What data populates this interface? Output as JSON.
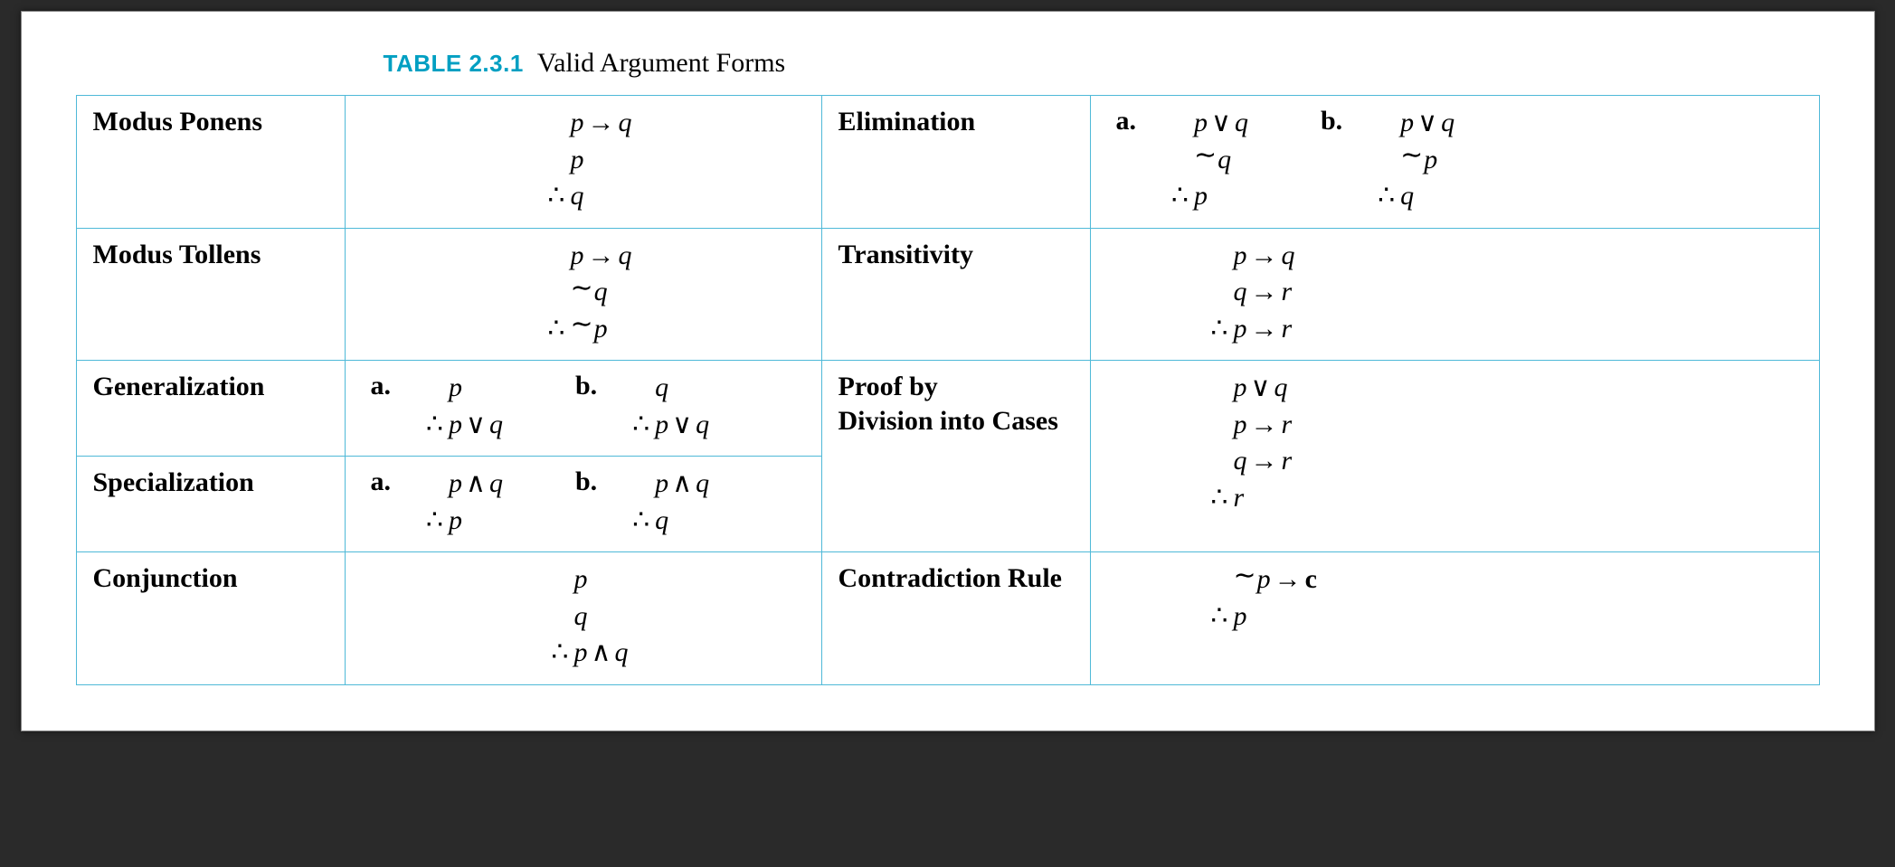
{
  "caption_label": "TABLE 2.3.1",
  "caption_title": "Valid Argument Forms",
  "sym": {
    "arrow": "→",
    "or": "∨",
    "and": "∧",
    "neg": "∼",
    "therefore": "∴"
  },
  "sub_a": "a.",
  "sub_b": "b.",
  "rows": {
    "modus_ponens": {
      "name": "Modus Ponens",
      "lines": [
        "p → q",
        "p",
        "∴ q"
      ]
    },
    "modus_tollens": {
      "name": "Modus Tollens",
      "lines": [
        "p → q",
        "∼q",
        "∴ ∼p"
      ]
    },
    "generalization": {
      "name": "Generalization",
      "a": [
        "p",
        "∴ p ∨ q"
      ],
      "b": [
        "q",
        "∴ p ∨ q"
      ]
    },
    "specialization": {
      "name": "Specialization",
      "a": [
        "p ∧ q",
        "∴ p"
      ],
      "b": [
        "p ∧ q",
        "∴ q"
      ]
    },
    "conjunction": {
      "name": "Conjunction",
      "lines": [
        "p",
        "q",
        "∴ p ∧ q"
      ]
    },
    "elimination": {
      "name": "Elimination",
      "a": [
        "p ∨ q",
        "∼q",
        "∴ p"
      ],
      "b": [
        "p ∨ q",
        "∼p",
        "∴ q"
      ]
    },
    "transitivity": {
      "name": "Transitivity",
      "lines": [
        "p → q",
        "q → r",
        "∴ p → r"
      ]
    },
    "division": {
      "name": "Proof by\nDivision into Cases",
      "lines": [
        "p ∨ q",
        "p → r",
        "q → r",
        "∴ r"
      ]
    },
    "contradiction": {
      "name": "Contradiction Rule",
      "lines": [
        "∼p → c",
        "∴ p"
      ]
    }
  }
}
